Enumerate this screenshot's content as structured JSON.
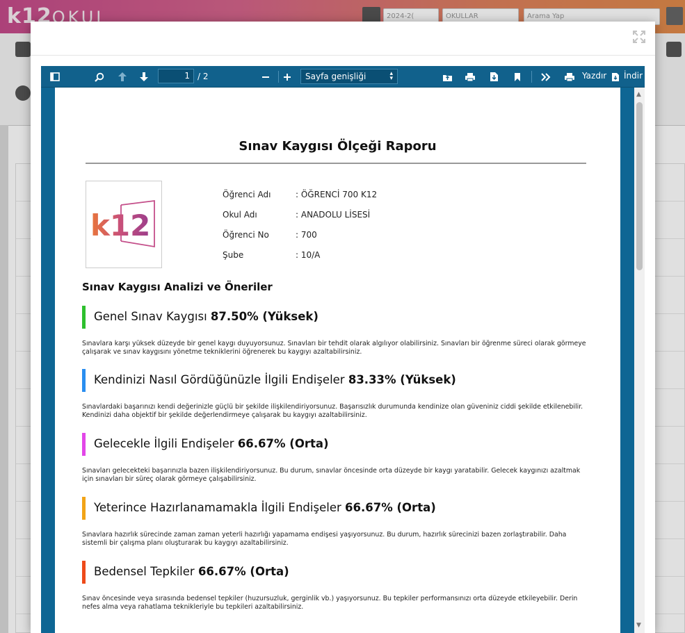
{
  "app": {
    "logo_main": "k12",
    "logo_sub": "OKUL",
    "year": "2024-2(",
    "school_select": "OKULLAR",
    "search_placeholder": "Arama Yap"
  },
  "modal": {
    "toolbar": {
      "page_current": "1",
      "page_total": "/ 2",
      "zoom": "Sayfa genişliği",
      "print_label": "Yazdır",
      "download_label": "İndir"
    },
    "report": {
      "title": "Sınav Kaygısı Ölçeği Raporu",
      "logo_text": "k12",
      "fields": [
        {
          "label": "Öğrenci Adı",
          "value": ": ÖĞRENCİ 700 K12"
        },
        {
          "label": "Okul Adı",
          "value": ": ANADOLU LİSESİ"
        },
        {
          "label": "Öğrenci No",
          "value": ": 700"
        },
        {
          "label": "Şube",
          "value": ": 10/A"
        }
      ],
      "section_title": "Sınav Kaygısı Analizi ve Öneriler",
      "categories": [
        {
          "name": "Genel Sınav Kaygısı",
          "score": "87.50% (Yüksek)",
          "color": "#2ec02e",
          "description": "Sınavlara karşı yüksek düzeyde bir genel kaygı duyuyorsunuz. Sınavları bir tehdit olarak algılıyor olabilirsiniz. Sınavları bir öğrenme süreci olarak görmeye çalışarak ve sınav kaygısını yönetme tekniklerini öğrenerek bu kaygıyı azaltabilirsiniz."
        },
        {
          "name": "Kendinizi Nasıl Gördüğünüzle İlgili Endişeler",
          "score": "83.33% (Yüksek)",
          "color": "#2a8ef0",
          "description": "Sınavlardaki başarınızı kendi değerinizle güçlü bir şekilde ilişkilendiriyorsunuz. Başarısızlık durumunda kendinize olan güveniniz ciddi şekilde etkilenebilir. Kendinizi daha objektif bir şekilde değerlendirmeye çalışarak bu kaygıyı azaltabilirsiniz."
        },
        {
          "name": "Gelecekle İlgili Endişeler",
          "score": "66.67% (Orta)",
          "color": "#e246e8",
          "description": "Sınavları gelecekteki başarınızla bazen ilişkilendiriyorsunuz. Bu durum, sınavlar öncesinde orta düzeyde bir kaygı yaratabilir. Gelecek kaygınızı azaltmak için sınavları bir süreç olarak görmeye çalışabilirsiniz."
        },
        {
          "name": "Yeterince Hazırlanamamakla İlgili Endişeler",
          "score": "66.67% (Orta)",
          "color": "#f2a417",
          "description": "Sınavlara hazırlık sürecinde zaman zaman yeterli hazırlığı yapamama endişesi yaşıyorsunuz. Bu durum, hazırlık sürecinizi bazen zorlaştırabilir. Daha sistemli bir çalışma planı oluşturarak bu kaygıyı azaltabilirsiniz."
        },
        {
          "name": "Bedensel Tepkiler",
          "score": "66.67% (Orta)",
          "color": "#ee4a1a",
          "description": "Sınav öncesinde veya sırasında bedensel tepkiler (huzursuzluk, gerginlik vb.) yaşıyorsunuz. Bu tepkiler performansınızı orta düzeyde etkileyebilir. Derin nefes alma veya rahatlama teknikleriyle bu tepkileri azaltabilirsiniz."
        }
      ]
    }
  }
}
